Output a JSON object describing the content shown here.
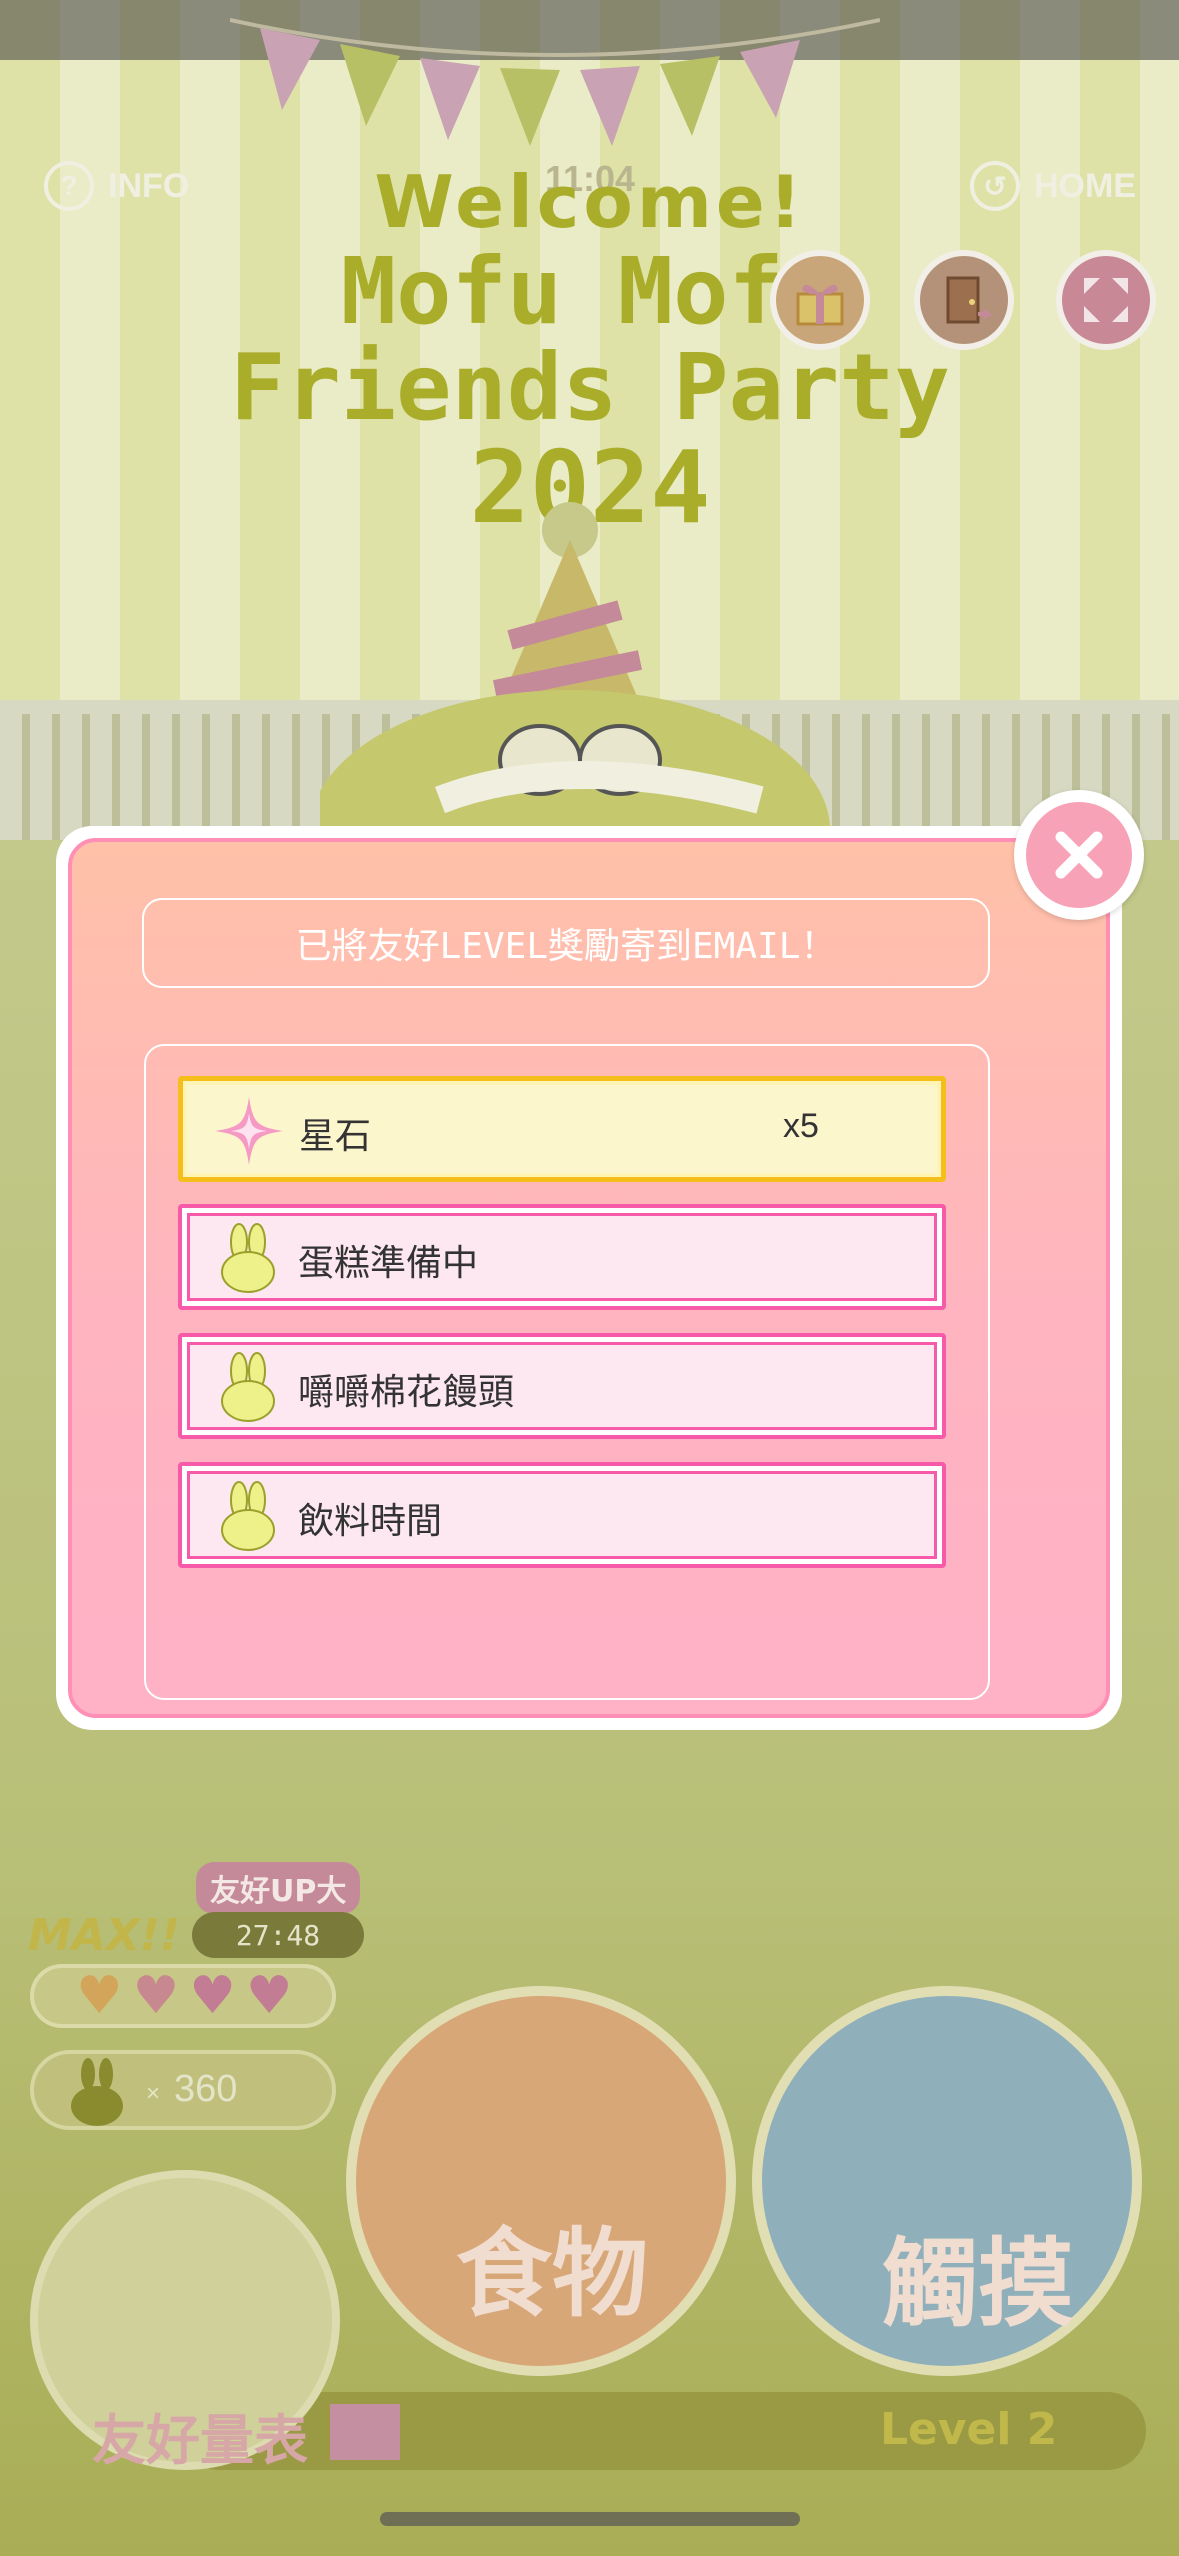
{
  "header": {
    "info_label": "INFO",
    "home_label": "HOME",
    "clock": "11:04",
    "info_icon": "question-icon",
    "home_icon": "back-arrow-icon"
  },
  "banner": {
    "line1": "Welcome!",
    "line2": "Mofu Mofu",
    "line3": "Friends Party",
    "line4": "2024"
  },
  "top_actions": [
    {
      "name": "gift-button",
      "icon": "gift-icon"
    },
    {
      "name": "exit-button",
      "icon": "door-icon"
    },
    {
      "name": "fullscreen-button",
      "icon": "expand-icon"
    }
  ],
  "modal": {
    "message": "已將友好LEVEL獎勵寄到EMAIL！",
    "close_icon": "close-icon",
    "rewards": [
      {
        "name": "星石",
        "qty": "x5",
        "icon": "sparkle-icon",
        "style": "gold"
      },
      {
        "name": "蛋糕準備中",
        "qty": "",
        "icon": "bunny-icon",
        "style": "pink"
      },
      {
        "name": "嚼嚼棉花饅頭",
        "qty": "",
        "icon": "bunny-icon",
        "style": "pink"
      },
      {
        "name": "飲料時間",
        "qty": "",
        "icon": "bunny-icon",
        "style": "pink"
      }
    ]
  },
  "hud": {
    "max_label": "MAX!!",
    "boost_label": "友好UP大",
    "timer": "27:48",
    "hearts": 4,
    "currency_prefix": "×",
    "currency_value": "360",
    "meter_label": "友好量表",
    "level_label": "Level 2",
    "food_label": "食物",
    "touch_label": "觸摸"
  },
  "colors": {
    "modal_pink": "#ffb4c0",
    "modal_peach": "#ffc1a8",
    "gold_border": "#f5be1a",
    "pink_border": "#f75aa8",
    "close_pink": "#f8a2b8"
  }
}
